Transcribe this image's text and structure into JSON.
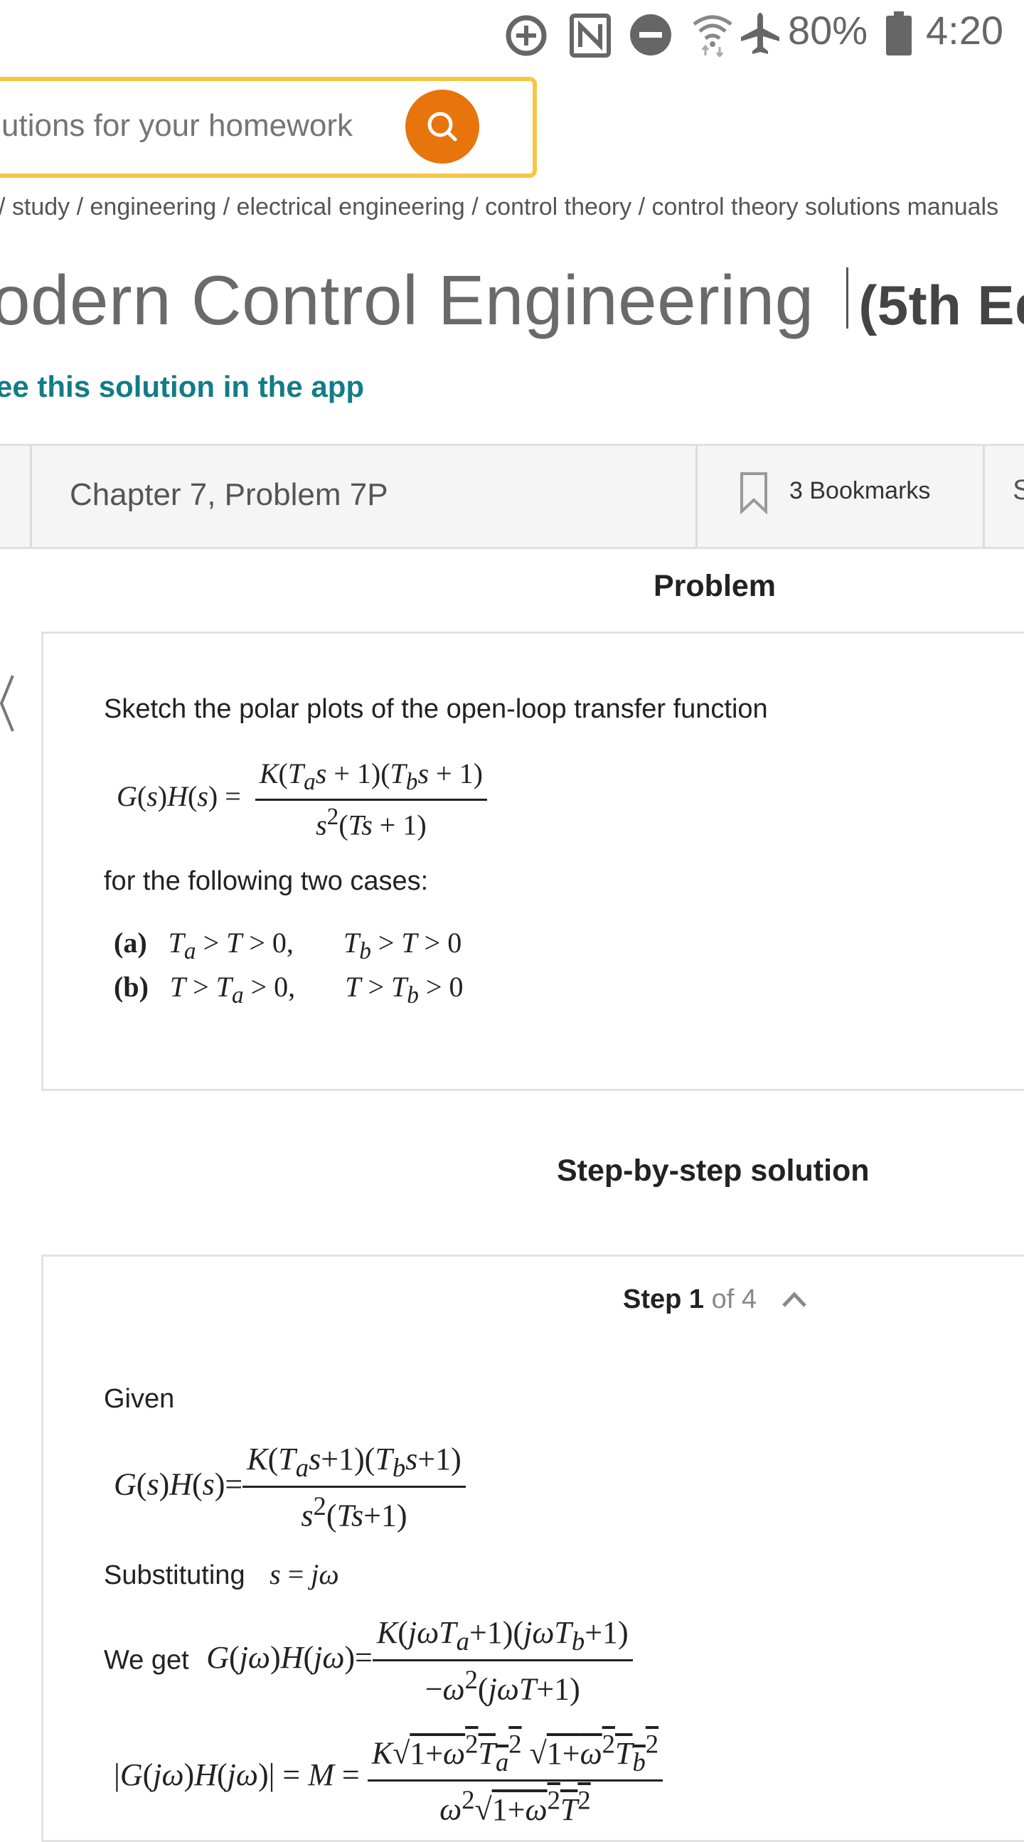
{
  "status_bar": {
    "battery_pct": "80%",
    "time": "4:20",
    "icons": [
      "data-saver-icon",
      "nfc-icon",
      "do-not-disturb-icon",
      "wifi-icon",
      "airplane-icon",
      "battery-icon"
    ]
  },
  "search": {
    "placeholder": "utions for your homework",
    "button_icon": "search-icon",
    "border_color": "#f7c646",
    "button_color": "#e8740c"
  },
  "breadcrumb": "/ study / engineering / electrical engineering / control theory / control theory solutions manuals",
  "book": {
    "title": "odern Control Engineering",
    "edition": "(5th Edi"
  },
  "app_link": "ee this solution in the app",
  "tabs": {
    "chapter": "Chapter 7, Problem 7P",
    "bookmarks": "3 Bookmarks",
    "share_partial": "S"
  },
  "problem": {
    "heading": "Problem",
    "intro": "Sketch the polar plots of the open-loop transfer function",
    "cases_intro": "for the following two cases:",
    "case_a_label": "(a)",
    "case_b_label": "(b)"
  },
  "solution": {
    "heading": "Step-by-step solution",
    "step_label": "Step",
    "step_number": "1",
    "step_of": "of 4",
    "given": "Given",
    "substituting": "Substituting",
    "we_get": "We get"
  },
  "colors": {
    "accent_teal": "#127c87",
    "text_gray": "#6a6a6a"
  }
}
